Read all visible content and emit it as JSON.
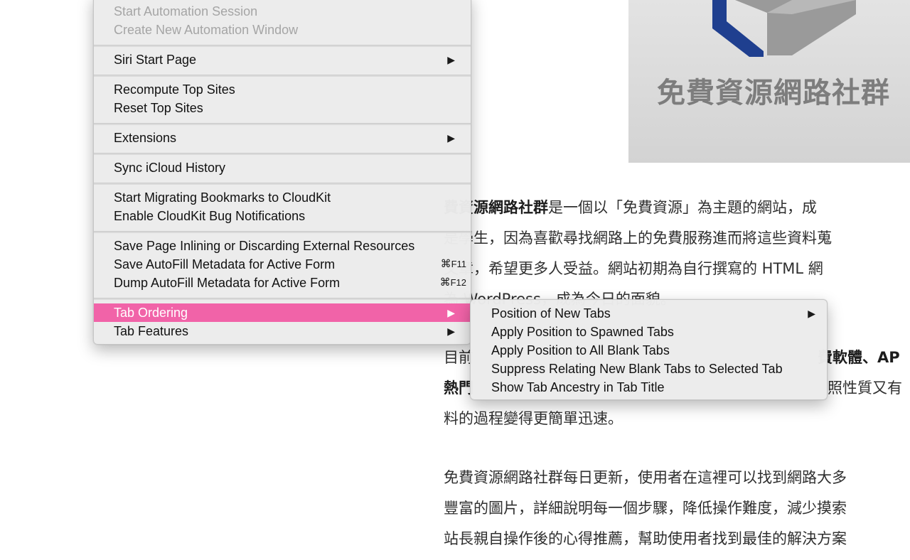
{
  "page": {
    "logo_text": "免費資源網路社群",
    "article": {
      "line1_bold": "費資源網路社群",
      "line1_rest": "是一個以「免費資源」為主題的網站，成",
      "line2": "是學生，因為喜歡尋找網路上的免費服務進而將這些資料蒐",
      "line3": "文章，希望更多人受益。網站初期為自行撰寫的 HTML 網",
      "line4": "為 WordPress，成為今日的面貌。",
      "line5a": "目前",
      "line5b": "費軟體、AP",
      "line6a": "熱門",
      "line6b": "照性質又有",
      "line7": "料的過程變得更簡單迅速。",
      "line8": "免費資源網路社群每日更新，使用者在這裡可以找到網路大多",
      "line9": "豐富的圖片，詳細說明每一個步驟，降低操作難度，減少摸索",
      "line10": "站長親自操作後的心得推薦，幫助使用者找到最佳的解決方案"
    }
  },
  "main_menu": {
    "start_automation_session": "Start Automation Session",
    "create_new_automation_window": "Create New Automation Window",
    "siri_start_page": "Siri Start Page",
    "recompute_top_sites": "Recompute Top Sites",
    "reset_top_sites": "Reset Top Sites",
    "extensions": "Extensions",
    "sync_icloud_history": "Sync iCloud History",
    "start_migrating_bookmarks": "Start Migrating Bookmarks to CloudKit",
    "enable_cloudkit_bug_notifications": "Enable CloudKit Bug Notifications",
    "save_page_inlining": "Save Page Inlining or Discarding External Resources",
    "save_autofill_metadata": "Save AutoFill Metadata for Active Form",
    "save_autofill_shortcut_cmd": "⌘",
    "save_autofill_shortcut_key": "F11",
    "dump_autofill_metadata": "Dump AutoFill Metadata for Active Form",
    "dump_autofill_shortcut_cmd": "⌘",
    "dump_autofill_shortcut_key": "F12",
    "tab_ordering": "Tab Ordering",
    "tab_features": "Tab Features",
    "submenu_arrow": "▶"
  },
  "submenu": {
    "position_of_new_tabs": "Position of New Tabs",
    "apply_position_spawned": "Apply Position to Spawned Tabs",
    "apply_position_blank": "Apply Position to All Blank Tabs",
    "suppress_relating": "Suppress Relating New Blank Tabs to Selected Tab",
    "show_tab_ancestry": "Show Tab Ancestry in Tab Title"
  },
  "colors": {
    "highlight": "#f163a8",
    "menu_background": "#ececec",
    "disabled_text": "#a5a5a5"
  }
}
